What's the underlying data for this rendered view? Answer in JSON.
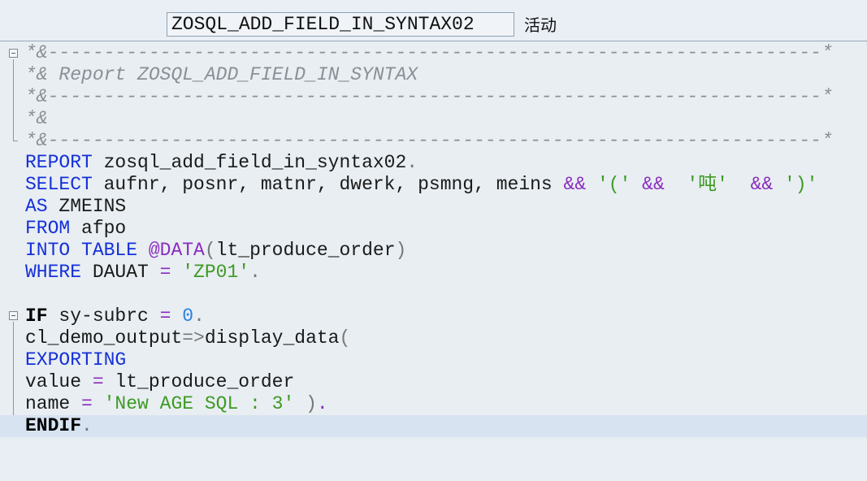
{
  "header": {
    "program_name": "ZOSQL_ADD_FIELD_IN_SYNTAX02",
    "status": "活动"
  },
  "code": {
    "comment_lines": [
      "*&---------------------------------------------------------------------*",
      "*& Report ZOSQL_ADD_FIELD_IN_SYNTAX",
      "*&---------------------------------------------------------------------*",
      "*&",
      "*&---------------------------------------------------------------------*"
    ],
    "l6": {
      "kw": "REPORT",
      "rest": " zosql_add_field_in_syntax02",
      "end": "."
    },
    "l7": {
      "kw": "SELECT",
      "fields": " aufnr, posnr, matnr, dwerk, psmng, meins ",
      "op1": "&&",
      "s1": " '(' ",
      "op2": "&&",
      "s2": "  '吨'  ",
      "op3": "&&",
      "s3": " ')'"
    },
    "l8": {
      "kw": "AS",
      "rest": " ZMEINS"
    },
    "l9": {
      "kw": "FROM",
      "rest": " afpo"
    },
    "l10": {
      "kw": "INTO TABLE",
      "at": " @DATA",
      "p1": "(",
      "rest": "lt_produce_order",
      "p2": ")"
    },
    "l11": {
      "kw": "WHERE",
      "rest": " DAUAT ",
      "eq": "=",
      "str": " 'ZP01'",
      "end": "."
    },
    "l13": {
      "kw": "IF",
      "rest": " sy-subrc ",
      "eq": "=",
      "num": " 0",
      "end": "."
    },
    "l14": {
      "a": "cl_demo_output",
      "arrow": "=>",
      "b": "display_data",
      "p": "("
    },
    "l15": {
      "kw": "EXPORTING"
    },
    "l16": {
      "a": "value ",
      "eq": "=",
      "b": " lt_produce_order"
    },
    "l17": {
      "a": "name ",
      "eq": "=",
      "str": " 'New AGE SQL : 3'",
      "p": " )",
      "end": "."
    },
    "l18": {
      "kw": "ENDIF",
      "end": "."
    }
  }
}
